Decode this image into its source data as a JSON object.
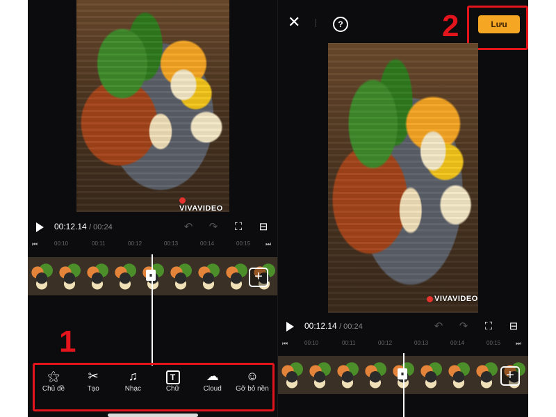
{
  "left": {
    "watermark": "VIVAVIDEO",
    "player": {
      "current_time": "00:12.14",
      "total_time": "/ 00:24"
    },
    "ruler_ticks": [
      "00:10",
      "00:11",
      "00:12",
      "00:13",
      "00:14",
      "00:15"
    ],
    "toolbar": [
      {
        "icon": "magic-wand-icon",
        "glyph": "⚝",
        "label": "Chủ đề"
      },
      {
        "icon": "scissors-icon",
        "glyph": "✂",
        "label": "Tạo"
      },
      {
        "icon": "music-note-icon",
        "glyph": "♫",
        "label": "Nhạc"
      },
      {
        "icon": "text-icon",
        "glyph": "T",
        "label": "Chữ"
      },
      {
        "icon": "cloud-upload-icon",
        "glyph": "☁",
        "label": "Cloud"
      },
      {
        "icon": "remove-background-icon",
        "glyph": "☺",
        "label": "Gỡ bỏ nền"
      }
    ],
    "annotation_number": "1"
  },
  "right": {
    "save_label": "Lưu",
    "help_glyph": "?",
    "close_glyph": "✕",
    "watermark": "VIVAVIDEO",
    "player": {
      "current_time": "00:12.14",
      "total_time": "/ 00:24"
    },
    "ruler_ticks": [
      "00:10",
      "00:11",
      "00:12",
      "00:13",
      "00:14",
      "00:15"
    ],
    "annotation_number": "2"
  },
  "colors": {
    "annotation_red": "#e3141b",
    "save_button": "#f5a623",
    "background": "#0c0c0e"
  }
}
